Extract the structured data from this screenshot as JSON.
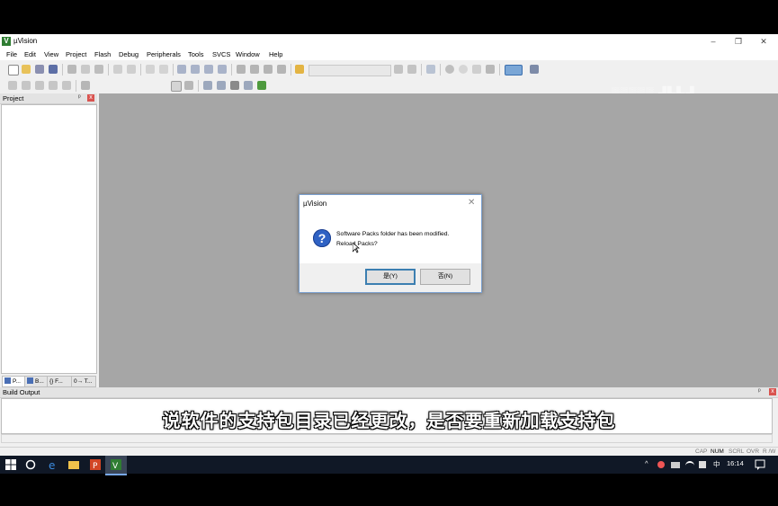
{
  "window": {
    "title": "µVision",
    "controls": {
      "minimize": "–",
      "restore": "❐",
      "close": "✕"
    }
  },
  "menu": [
    "File",
    "Edit",
    "View",
    "Project",
    "Flash",
    "Debug",
    "Peripherals",
    "Tools",
    "SVCS",
    "Window",
    "Help"
  ],
  "project_panel": {
    "title": "Project",
    "pin": "ᵖ",
    "close": "x",
    "tabs": [
      "P...",
      "B...",
      "{} F...",
      "0→ T..."
    ]
  },
  "dialog": {
    "title": "µVision",
    "close": "✕",
    "icon": "question-icon",
    "message_line1": "Software Packs folder has been modified.",
    "message_line2": "Reload Packs?",
    "yes_label": "是(Y)",
    "no_label": "否(N)"
  },
  "build_output": {
    "title": "Build Output",
    "pin": "ᵖ",
    "close": "x"
  },
  "status_bar": {
    "cap": "CAP",
    "num": "NUM",
    "scrl": "SCRL",
    "ovr": "OVR",
    "rw": "R /W"
  },
  "subtitle": "说软件的支持包目录已经更改，是否要重新加载支持包",
  "taskbar": {
    "time": "16:14",
    "ime": "中",
    "caret": "^"
  },
  "colors": {
    "workspace_gray": "#a6a6a6",
    "dialog_border": "#7aa0d0",
    "question_blue": "#2f62c4",
    "taskbar_bg": "#101826"
  }
}
